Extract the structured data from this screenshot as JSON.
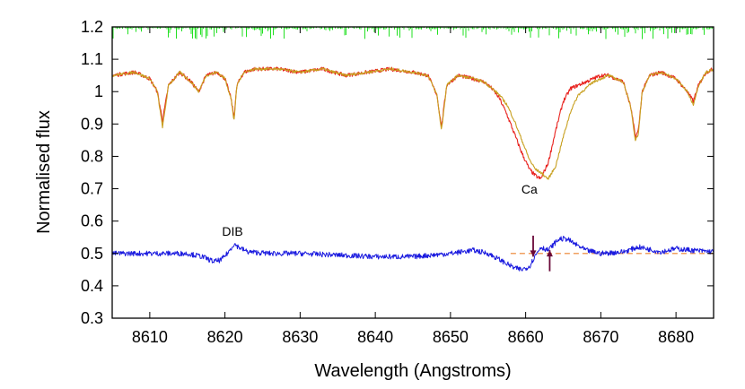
{
  "chart_data": {
    "type": "line",
    "xlabel": "Wavelength (Angstroms)",
    "ylabel": "Normalised flux",
    "xlim": [
      8605,
      8685
    ],
    "ylim": [
      0.3,
      1.2
    ],
    "x_ticks": [
      "8610",
      "8620",
      "8630",
      "8640",
      "8650",
      "8660",
      "8670",
      "8680"
    ],
    "y_ticks": [
      "0.3",
      "0.4",
      "0.5",
      "0.6",
      "0.7",
      "0.8",
      "0.9",
      "1",
      "1.1",
      "1.2"
    ],
    "grid": false,
    "colors": {
      "observed": "#e8201c",
      "model": "#c8a020",
      "residual": "#1a1adf",
      "telluric": "#22e022",
      "baseline": "#f0a060",
      "arrow": "#6a0838"
    },
    "series": [
      {
        "key": "observed",
        "x": [
          8605,
          8608,
          8610,
          8611,
          8611.7,
          8612.5,
          8614,
          8615.5,
          8616.5,
          8617.5,
          8619,
          8620,
          8620.8,
          8621.2,
          8621.6,
          8622.5,
          8624,
          8627,
          8630,
          8633,
          8636,
          8639,
          8642,
          8645,
          8647,
          8648.2,
          8648.8,
          8649.5,
          8651,
          8653,
          8654.5,
          8655.5,
          8656.5,
          8657.5,
          8658.5,
          8659.5,
          8660.5,
          8661.3,
          8662,
          8663,
          8664,
          8665,
          8666,
          8667,
          8668,
          8669,
          8670,
          8671,
          8672,
          8673,
          8674,
          8674.6,
          8675,
          8675.5,
          8676.5,
          8678,
          8680,
          8681.5,
          8682.3,
          8683,
          8684,
          8685
        ],
        "y": [
          1.05,
          1.06,
          1.04,
          1.0,
          0.91,
          1.02,
          1.06,
          1.03,
          1.0,
          1.05,
          1.06,
          1.04,
          0.98,
          0.92,
          1.02,
          1.06,
          1.07,
          1.07,
          1.06,
          1.07,
          1.05,
          1.06,
          1.07,
          1.06,
          1.05,
          0.99,
          0.89,
          1.02,
          1.05,
          1.04,
          1.03,
          1.01,
          0.98,
          0.93,
          0.87,
          0.81,
          0.76,
          0.74,
          0.73,
          0.78,
          0.88,
          0.97,
          1.01,
          1.02,
          1.03,
          1.04,
          1.05,
          1.05,
          1.04,
          1.03,
          0.95,
          0.86,
          0.88,
          1.0,
          1.05,
          1.06,
          1.04,
          1.0,
          0.97,
          1.02,
          1.06,
          1.07
        ]
      },
      {
        "key": "model",
        "x": [
          8605,
          8608,
          8610,
          8611,
          8611.7,
          8612.5,
          8614,
          8615.5,
          8616.5,
          8617.5,
          8619,
          8620,
          8620.8,
          8621.2,
          8621.6,
          8622.5,
          8624,
          8627,
          8630,
          8633,
          8636,
          8639,
          8642,
          8645,
          8647,
          8648.2,
          8648.8,
          8649.5,
          8651,
          8653,
          8654.5,
          8655.5,
          8656.5,
          8657.5,
          8658.5,
          8659.5,
          8660.5,
          8661.3,
          8662,
          8663,
          8664,
          8665,
          8666,
          8667,
          8668,
          8669,
          8670,
          8671,
          8672,
          8673,
          8674,
          8674.6,
          8675,
          8675.5,
          8676.5,
          8678,
          8680,
          8681.5,
          8682.3,
          8683,
          8684,
          8685
        ],
        "y": [
          1.05,
          1.06,
          1.04,
          1.0,
          0.89,
          1.02,
          1.06,
          1.03,
          1.0,
          1.05,
          1.06,
          1.04,
          0.98,
          0.91,
          1.02,
          1.06,
          1.07,
          1.07,
          1.06,
          1.07,
          1.05,
          1.06,
          1.07,
          1.06,
          1.05,
          0.99,
          0.88,
          1.02,
          1.05,
          1.04,
          1.03,
          1.01,
          0.99,
          0.96,
          0.91,
          0.85,
          0.79,
          0.76,
          0.75,
          0.73,
          0.77,
          0.86,
          0.94,
          0.99,
          1.01,
          1.03,
          1.04,
          1.05,
          1.04,
          1.03,
          0.95,
          0.85,
          0.87,
          1.0,
          1.05,
          1.06,
          1.04,
          1.0,
          0.96,
          1.02,
          1.06,
          1.07
        ]
      },
      {
        "key": "residual",
        "x": [
          8605,
          8610,
          8615,
          8617,
          8618.5,
          8619.5,
          8620.5,
          8621.2,
          8621.8,
          8623,
          8626,
          8630,
          8635,
          8640,
          8645,
          8650,
          8653,
          8655,
          8657,
          8658.5,
          8659.5,
          8660.5,
          8661.2,
          8662,
          8663,
          8663.8,
          8664.5,
          8665.5,
          8666.5,
          8668,
          8670,
          8673,
          8675,
          8678,
          8680,
          8682,
          8685
        ],
        "y": [
          0.5,
          0.5,
          0.5,
          0.49,
          0.475,
          0.48,
          0.505,
          0.53,
          0.52,
          0.505,
          0.5,
          0.5,
          0.495,
          0.49,
          0.49,
          0.5,
          0.51,
          0.5,
          0.475,
          0.455,
          0.45,
          0.46,
          0.49,
          0.52,
          0.51,
          0.53,
          0.545,
          0.545,
          0.53,
          0.51,
          0.5,
          0.505,
          0.52,
          0.505,
          0.515,
          0.51,
          0.505
        ]
      }
    ],
    "annotations": [
      {
        "text": "Ca",
        "x": 8660.5,
        "y": 0.685
      },
      {
        "text": "DIB",
        "x": 8621,
        "y": 0.555
      }
    ],
    "reference_lines": [
      {
        "y": 0.5,
        "x_from": 8658,
        "x_to": 8685,
        "style": "dashed"
      }
    ],
    "arrows": [
      {
        "x": 8661,
        "y_from": 0.555,
        "y_to": 0.49
      },
      {
        "x": 8663.2,
        "y_from": 0.445,
        "y_to": 0.51
      }
    ]
  }
}
